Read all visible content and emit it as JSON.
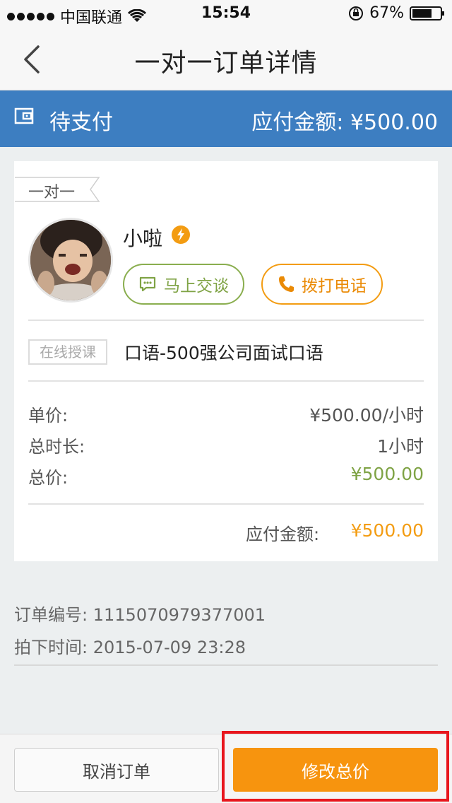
{
  "status_bar": {
    "carrier": "中国联通",
    "time": "15:54",
    "battery": "67%"
  },
  "nav": {
    "title": "一对一订单详情"
  },
  "banner": {
    "status": "待支付",
    "amount_label": "应付金额:",
    "amount": "¥500.00"
  },
  "card": {
    "type_tag": "一对一",
    "teacher_name": "小啦",
    "chat_button": "马上交谈",
    "call_button": "拨打电话",
    "course_tag": "在线授课",
    "course_title": "口语-500强公司面试口语",
    "rows": [
      {
        "label": "单价:",
        "value": "¥500.00/小时"
      },
      {
        "label": "总时长:",
        "value": "1小时"
      },
      {
        "label": "总价:",
        "value": "¥500.00"
      }
    ],
    "payable_label": "应付金额:",
    "payable_value": "¥500.00"
  },
  "order": {
    "number_label": "订单编号:",
    "number": "1115070979377001",
    "time_label": "拍下时间:",
    "time": "2015-07-09 23:28"
  },
  "actions": {
    "cancel": "取消订单",
    "modify": "修改总价"
  },
  "colors": {
    "banner": "#3d7ec1",
    "accent_orange": "#f7940e",
    "accent_green": "#7fa345",
    "highlight": "#e8161d"
  }
}
